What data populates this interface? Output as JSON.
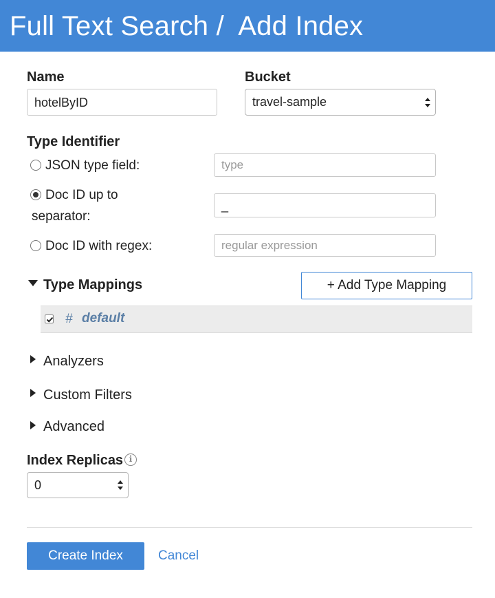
{
  "header": {
    "title": "Full Text Search /  Add Index"
  },
  "form": {
    "name_label": "Name",
    "name_value": "hotelByID",
    "bucket_label": "Bucket",
    "bucket_value": "travel-sample",
    "type_identifier": {
      "label": "Type Identifier",
      "options": [
        {
          "label": "JSON type field:",
          "placeholder": "type",
          "selected": false
        },
        {
          "label_line1": "Doc ID up to",
          "label_line2": "separator:",
          "value": "_",
          "selected": true
        },
        {
          "label": "Doc ID with regex:",
          "placeholder": "regular expression",
          "selected": false
        }
      ]
    },
    "type_mappings": {
      "label": "Type Mappings",
      "expanded": true,
      "add_button": "+ Add Type Mapping",
      "items": [
        {
          "hash": "#",
          "name": "default",
          "checked": true
        }
      ]
    },
    "sections": {
      "analyzers": "Analyzers",
      "custom_filters": "Custom Filters",
      "advanced": "Advanced"
    },
    "index_replicas": {
      "label": "Index Replicas",
      "value": "0",
      "info_icon": "info-icon"
    }
  },
  "actions": {
    "create_label": "Create Index",
    "cancel_label": "Cancel"
  },
  "colors": {
    "accent": "#4287d6",
    "mapping_bg": "#ececec",
    "mapping_text": "#5b7fa6"
  }
}
